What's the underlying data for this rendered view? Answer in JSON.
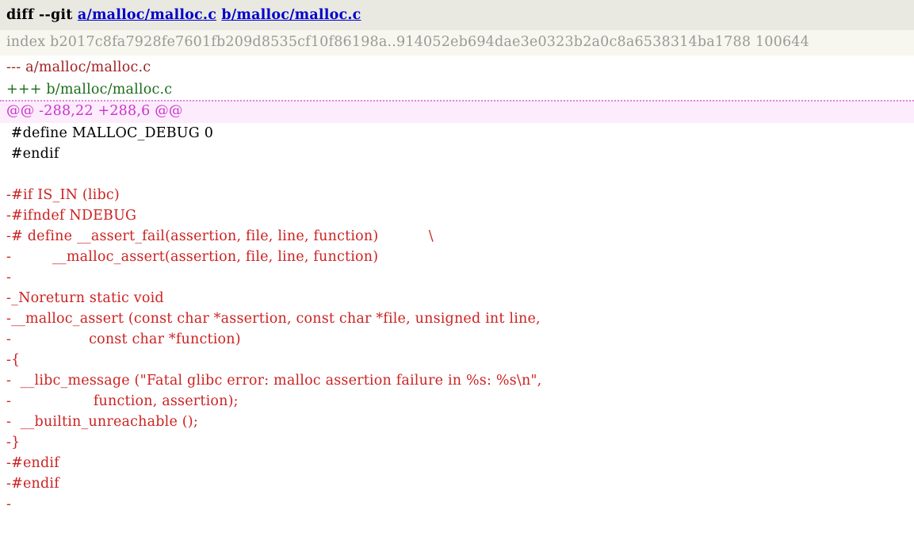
{
  "diff": {
    "command": {
      "prefix": "diff --git ",
      "old_path": "a/malloc/malloc.c",
      "separator": " ",
      "new_path": "b/malloc/malloc.c"
    },
    "index_line": "index b2017c8fa7928fe7601fb209d8535cf10f86198a..914052eb694dae3e0323b2a0c8a6538314ba1788 100644",
    "old_file_line": "--- a/malloc/malloc.c",
    "new_file_line": "+++ b/malloc/malloc.c",
    "hunk_header": "@@ -288,22 +288,6 @@",
    "lines": [
      {
        "type": "context",
        "text": " #define MALLOC_DEBUG 0"
      },
      {
        "type": "context",
        "text": " #endif"
      },
      {
        "type": "context",
        "text": ""
      },
      {
        "type": "del",
        "text": "-#if IS_IN (libc)"
      },
      {
        "type": "del",
        "text": "-#ifndef NDEBUG"
      },
      {
        "type": "del",
        "text": "-# define __assert_fail(assertion, file, line, function)           \\"
      },
      {
        "type": "del",
        "text": "-         __malloc_assert(assertion, file, line, function)"
      },
      {
        "type": "del",
        "text": "-"
      },
      {
        "type": "del",
        "text": "-_Noreturn static void"
      },
      {
        "type": "del",
        "text": "-__malloc_assert (const char *assertion, const char *file, unsigned int line,"
      },
      {
        "type": "del",
        "text": "-                 const char *function)"
      },
      {
        "type": "del",
        "text": "-{"
      },
      {
        "type": "del",
        "text": "-  __libc_message (\"Fatal glibc error: malloc assertion failure in %s: %s\\n\","
      },
      {
        "type": "del",
        "text": "-                  function, assertion);"
      },
      {
        "type": "del",
        "text": "-  __builtin_unreachable ();"
      },
      {
        "type": "del",
        "text": "-}"
      },
      {
        "type": "del",
        "text": "-#endif"
      },
      {
        "type": "del",
        "text": "-#endif"
      },
      {
        "type": "del",
        "text": "-"
      }
    ]
  },
  "colors": {
    "added": "#1a7a1a",
    "removed": "#cc2222",
    "hunk": "#cc33cc",
    "index": "#999999",
    "link": "#0000cc",
    "old_file": "#a02020",
    "context": "#000000",
    "diffcmd_bg": "#e9e9e1",
    "index_bg": "#f7f7ef",
    "hunk_bg": "#fcecfc"
  }
}
